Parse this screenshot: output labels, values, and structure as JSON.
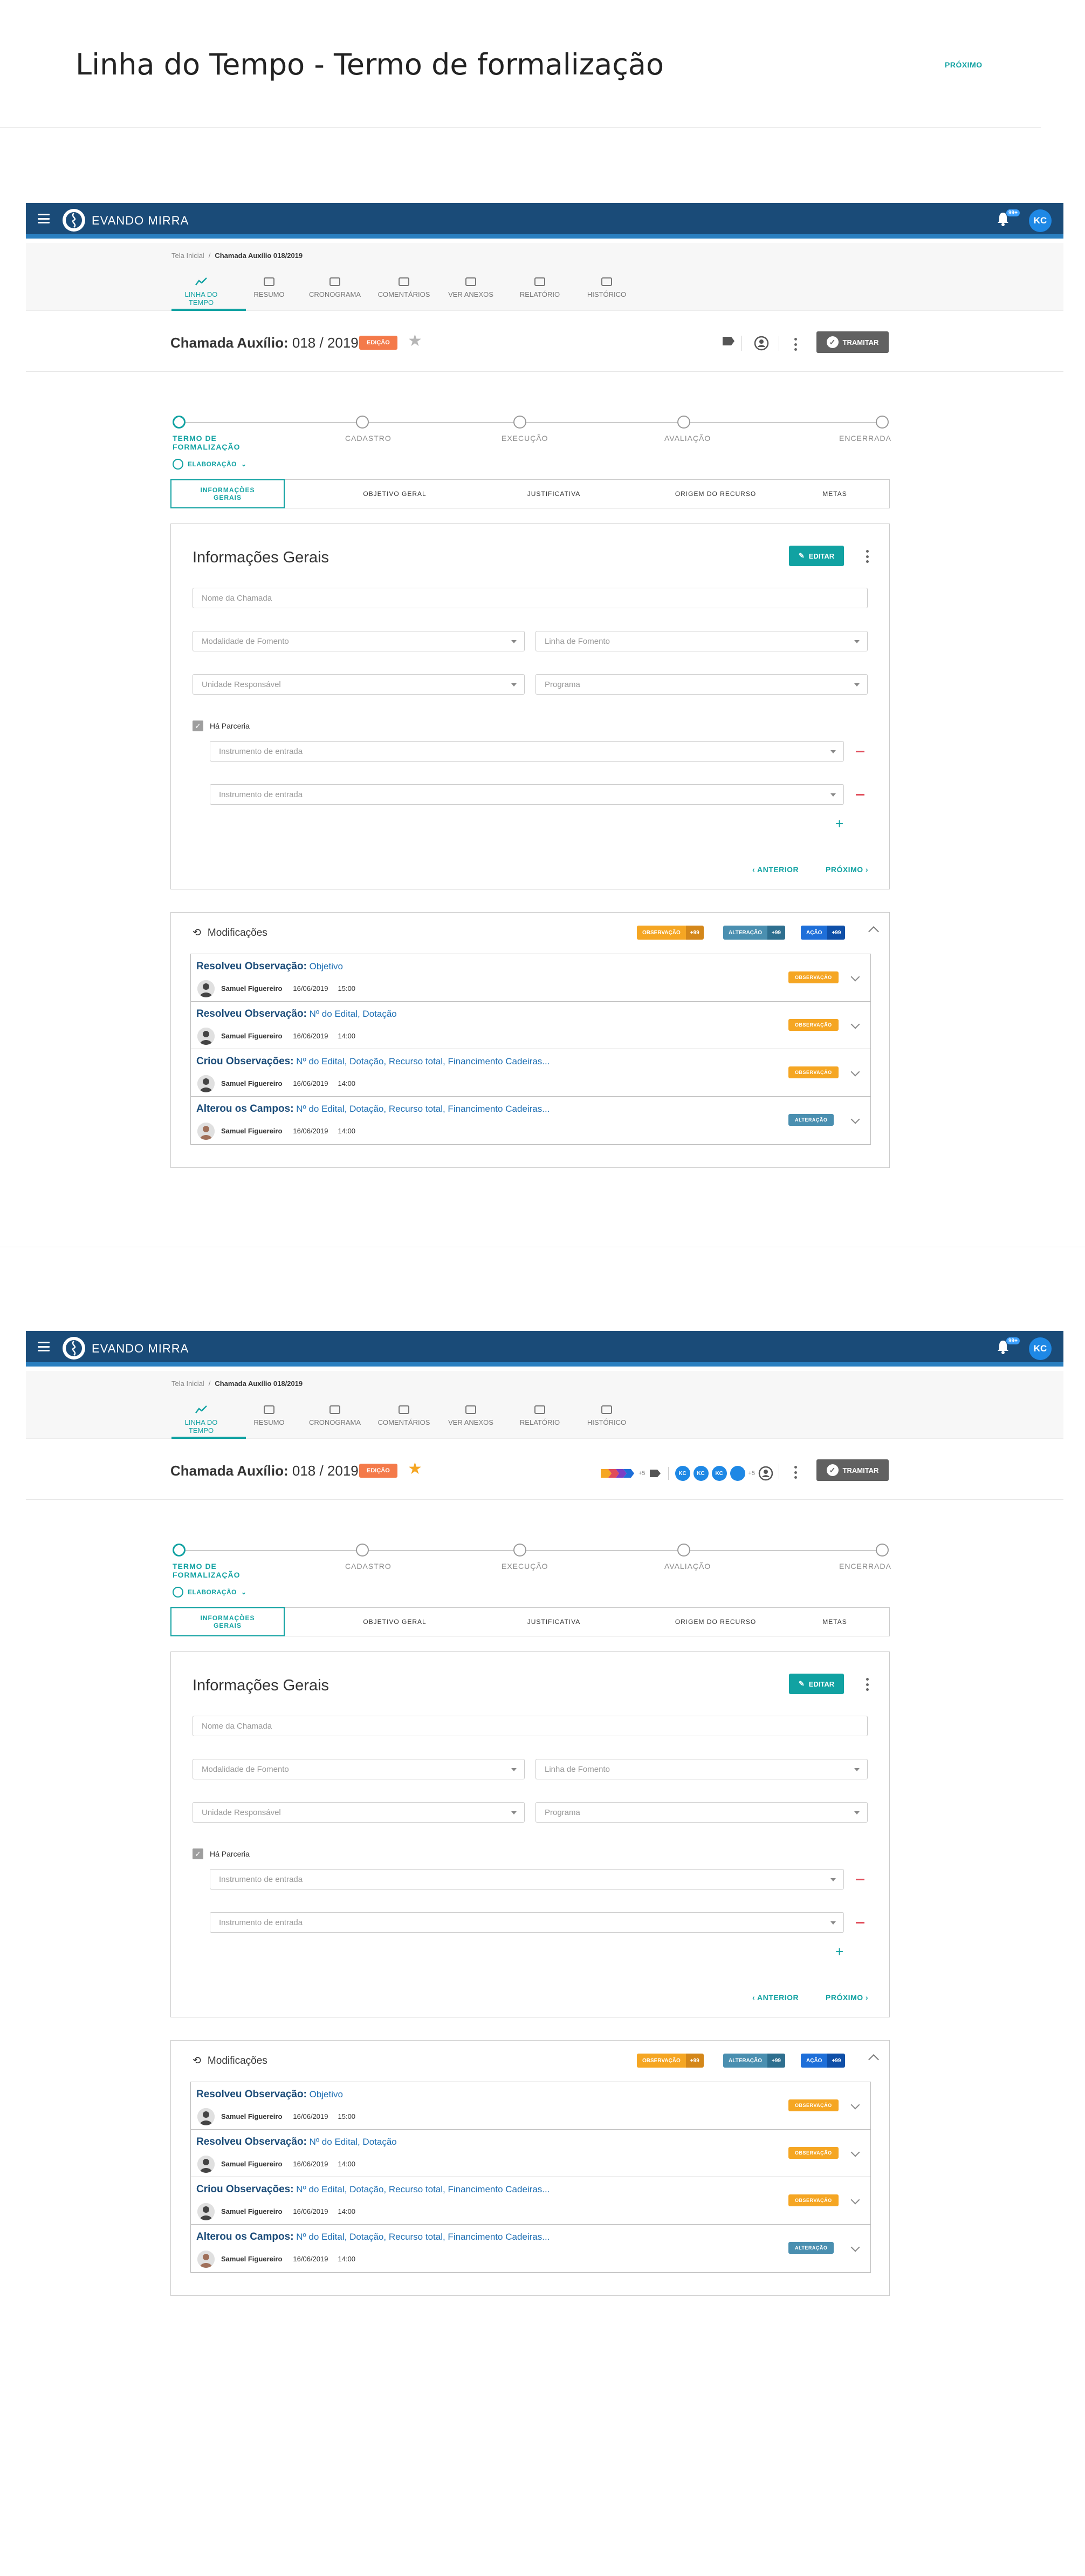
{
  "page": {
    "title": "Linha do Tempo - Termo de formalização",
    "next_label": "PRÓXIMO"
  },
  "colors": {
    "teal": "#11a2a2",
    "navy": "#1a4b78",
    "orange": "#f5a623",
    "badge_edit": "#f47a4a",
    "alteracao": "#4a8fb0",
    "acao": "#1e6fd9"
  },
  "app": {
    "brand": "EVANDO MIRRA",
    "notifications": "99+",
    "user_initials": "KC",
    "breadcrumb": {
      "home": "Tela Inicial",
      "sep": "/",
      "current": "Chamada Auxílio 018/2019"
    },
    "tabs": [
      {
        "label": "LINHA DO TEMPO",
        "icon": "timeline-icon"
      },
      {
        "label": "RESUMO",
        "icon": "list-icon"
      },
      {
        "label": "CRONOGRAMA",
        "icon": "alarm-icon"
      },
      {
        "label": "COMENTÁRIOS",
        "icon": "comment-icon"
      },
      {
        "label": "VER ANEXOS",
        "icon": "eye-icon"
      },
      {
        "label": "RELATÓRIO",
        "icon": "report-icon"
      },
      {
        "label": "HISTÓRICO",
        "icon": "history-icon"
      }
    ],
    "title_bold": "Chamada Auxílio:",
    "title_rest": " 018 / 2019",
    "status_badge": "EDIÇÃO",
    "tramitar": "TRAMITAR",
    "participants": [
      "KC",
      "KC",
      "KC"
    ],
    "more_participants": "+5"
  },
  "stepper": {
    "steps": [
      "TERMO DE FORMALIZAÇÃO",
      "CADASTRO",
      "EXECUÇÃO",
      "AVALIAÇÃO",
      "ENCERRADA"
    ],
    "phase": "ELABORAÇÃO"
  },
  "subtabs": [
    "INFORMAÇÕES GERAIS",
    "OBJETIVO GERAL",
    "JUSTIFICATIVA",
    "ORIGEM DO RECURSO",
    "METAS"
  ],
  "form": {
    "title": "Informações Gerais",
    "edit_label": "EDITAR",
    "nome_placeholder": "Nome da Chamada",
    "modalidade": "Modalidade de Fomento",
    "linha": "Linha de Fomento",
    "unidade": "Unidade Responsável",
    "programa": "Programa",
    "parceria": "Há Parceria",
    "instrumento": "Instrumento de entrada",
    "anterior": "ANTERIOR",
    "proximo": "PRÓXIMO"
  },
  "mods": {
    "title": "Modificações",
    "badges": [
      {
        "label": "OBSERVAÇÃO",
        "count": "+99"
      },
      {
        "label": "ALTERAÇÃO",
        "count": "+99"
      },
      {
        "label": "AÇÃO",
        "count": "+99"
      }
    ],
    "items": [
      {
        "action": "Resolveu Observação:",
        "detail": " Objetivo",
        "user": "Samuel Figuereiro",
        "date": "16/06/2019",
        "time": "15:00",
        "badge": "OBSERVAÇÃO",
        "type": "obs"
      },
      {
        "action": "Resolveu Observação:",
        "detail": " Nº do Edital, Dotação",
        "user": "Samuel Figuereiro",
        "date": "16/06/2019",
        "time": "14:00",
        "badge": "OBSERVAÇÃO",
        "type": "obs"
      },
      {
        "action": "Criou Observações:",
        "detail": " Nº do Edital, Dotação, Recurso total, Financimento Cadeiras...",
        "user": "Samuel Figuereiro",
        "date": "16/06/2019",
        "time": "14:00",
        "badge": "OBSERVAÇÃO",
        "type": "obs"
      },
      {
        "action": "Alterou os Campos:",
        "detail": " Nº do Edital, Dotação, Recurso total, Financimento Cadeiras...",
        "user": "Samuel Figuereiro",
        "date": "16/06/2019",
        "time": "14:00",
        "badge": "ALTERAÇÃO",
        "type": "alt"
      }
    ]
  }
}
